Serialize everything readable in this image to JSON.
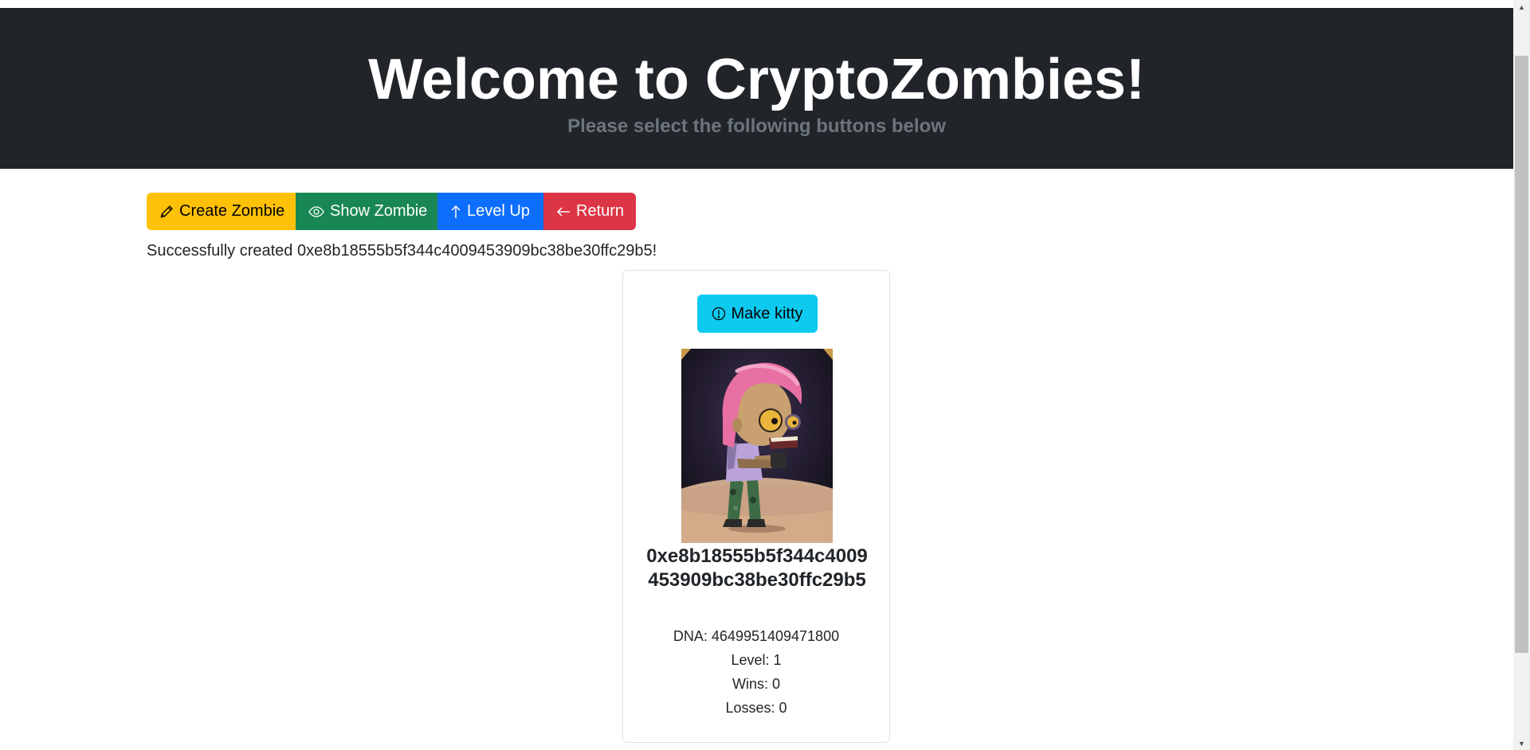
{
  "header": {
    "title": "Welcome to CryptoZombies!",
    "subtitle": "Please select the following buttons below"
  },
  "toolbar": {
    "create_label": "Create Zombie",
    "create_icon": "pencil-icon",
    "show_label": "Show Zombie",
    "show_icon": "eye-icon",
    "level_label": "Level Up",
    "level_icon": "arrow-up-icon",
    "return_label": "Return",
    "return_icon": "arrow-left-icon"
  },
  "status_message": "Successfully created 0xe8b18555b5f344c4009453909bc38be30ffc29b5!",
  "zombie_card": {
    "kitty_button_label": "Make kitty",
    "kitty_button_icon": "exclamation-circle-icon",
    "name": "0xe8b18555b5f344c4009453909bc38be30ffc29b5",
    "dna_line": "DNA: 4649951409471800",
    "level_line": "Level: 1",
    "wins_line": "Wins: 0",
    "losses_line": "Losses: 0"
  },
  "colors": {
    "hero_bg": "#212529",
    "create": "#ffc107",
    "show": "#198754",
    "level": "#0d6efd",
    "return": "#dc3545",
    "kitty": "#0dcaf0"
  }
}
